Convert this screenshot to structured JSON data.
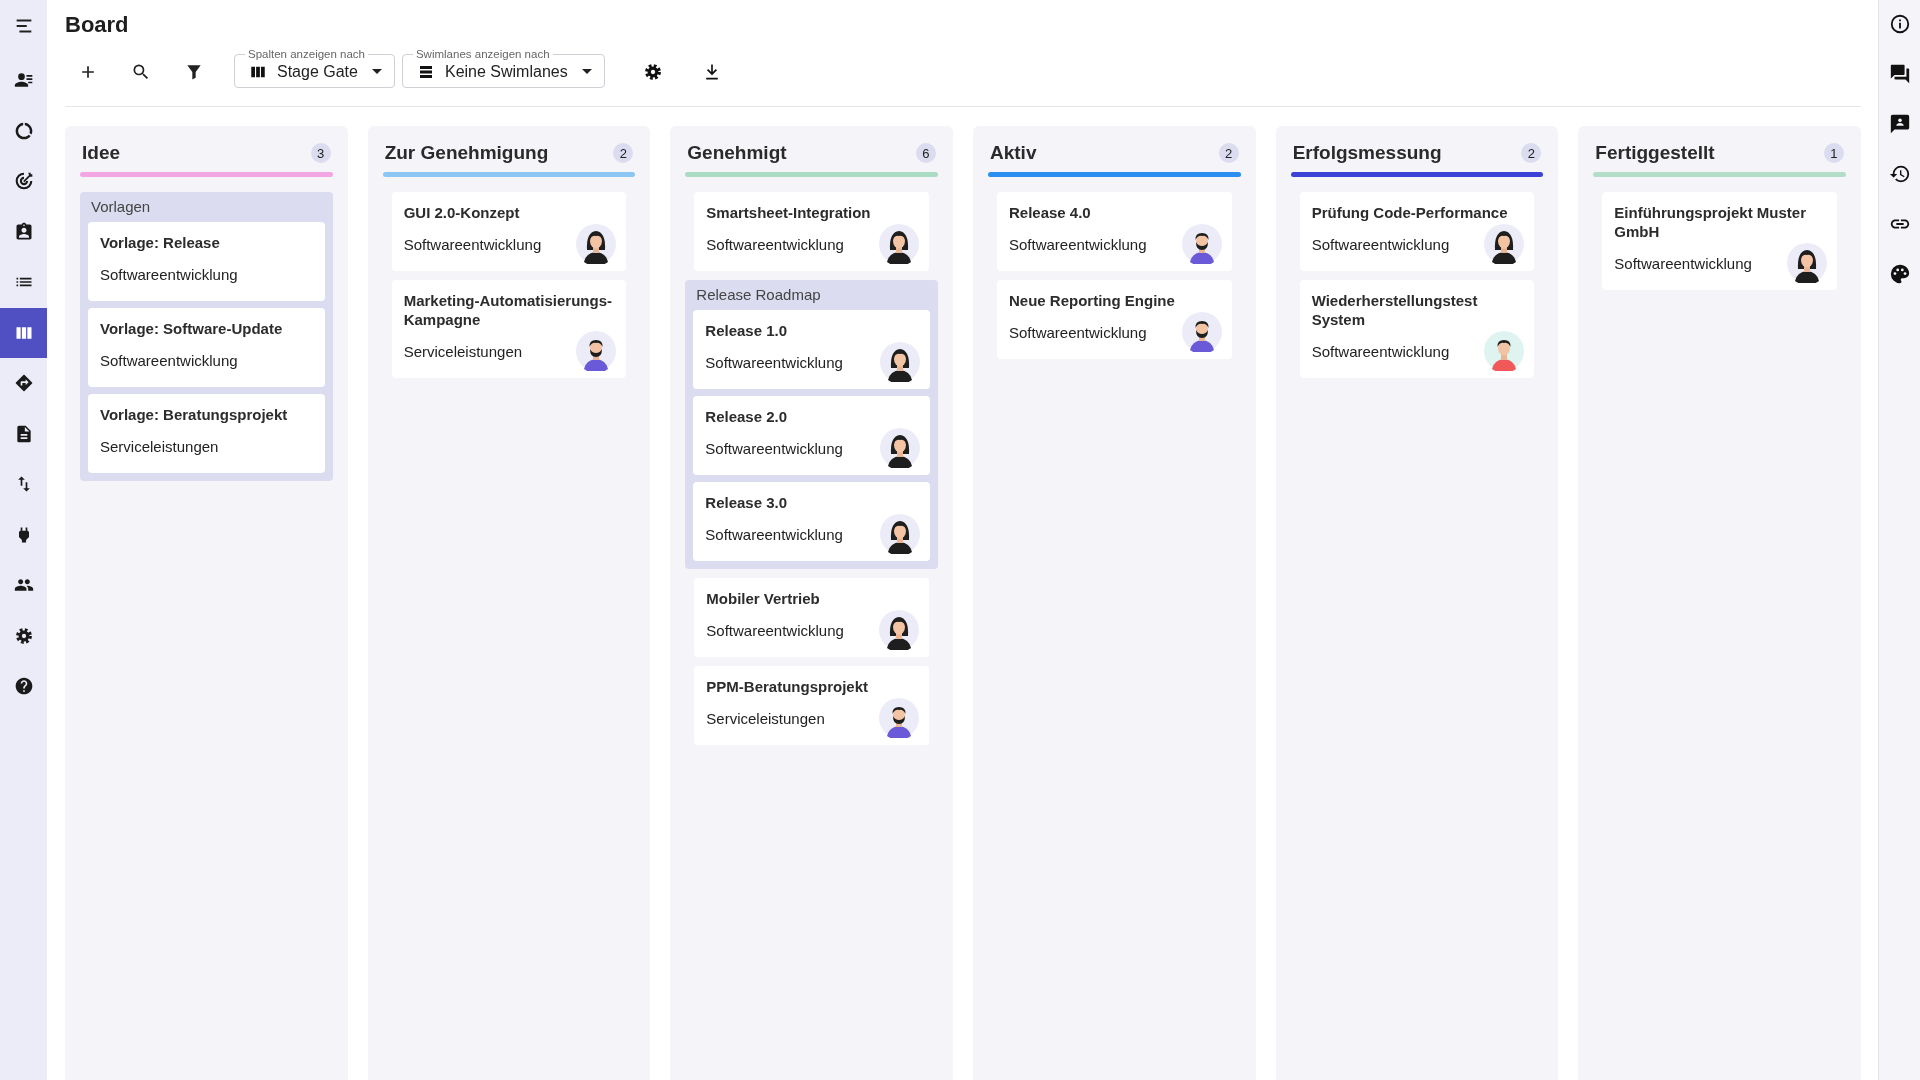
{
  "app": {
    "title": "Board"
  },
  "nav": [
    {
      "selected": false
    },
    {
      "selected": false
    },
    {
      "selected": false
    },
    {
      "selected": false
    },
    {
      "selected": false
    },
    {
      "selected": true
    },
    {
      "selected": false
    },
    {
      "selected": false
    },
    {
      "selected": false
    },
    {
      "selected": false
    },
    {
      "selected": false
    },
    {
      "selected": false
    },
    {
      "selected": false
    }
  ],
  "toolbar": {
    "columns_select": {
      "label": "Spalten anzeigen nach",
      "value": "Stage Gate"
    },
    "swimlanes_select": {
      "label": "Swimlanes anzeigen nach",
      "value": "Keine Swimlanes"
    }
  },
  "columns": [
    {
      "title": "Idee",
      "count": "3",
      "color": "#f2a6e4",
      "items": [
        {
          "kind": "group",
          "label": "Vorlagen",
          "cards": [
            {
              "title": "Vorlage: Release",
              "subtitle": "Softwareentwicklung"
            },
            {
              "title": "Vorlage: Software-Update",
              "subtitle": "Softwareentwicklung"
            },
            {
              "title": "Vorlage: Beratungsprojekt",
              "subtitle": "Serviceleistungen"
            }
          ]
        }
      ]
    },
    {
      "title": "Zur Genehmigung",
      "count": "2",
      "color": "#8cc6f2",
      "items": [
        {
          "kind": "card",
          "title": "GUI 2.0-Konzept",
          "subtitle": "Softwareentwicklung",
          "avatar": {
            "kind": "a"
          }
        },
        {
          "kind": "card",
          "title": "Marketing-Automatisierungs-Kampagne",
          "subtitle": "Serviceleistungen",
          "avatar": {
            "kind": "b"
          }
        }
      ]
    },
    {
      "title": "Genehmigt",
      "count": "6",
      "color": "#a9dcc3",
      "items": [
        {
          "kind": "card",
          "title": "Smartsheet-Integration",
          "subtitle": "Softwareentwicklung",
          "avatar": {
            "kind": "a"
          }
        },
        {
          "kind": "group",
          "label": "Release Roadmap",
          "cards": [
            {
              "title": "Release 1.0",
              "subtitle": "Softwareentwicklung",
              "avatar": {
                "kind": "a"
              }
            },
            {
              "title": "Release 2.0",
              "subtitle": "Softwareentwicklung",
              "avatar": {
                "kind": "a"
              }
            },
            {
              "title": "Release 3.0",
              "subtitle": "Softwareentwicklung",
              "avatar": {
                "kind": "a"
              }
            }
          ]
        },
        {
          "kind": "card",
          "title": "Mobiler Vertrieb",
          "subtitle": "Softwareentwicklung",
          "avatar": {
            "kind": "a"
          }
        },
        {
          "kind": "card",
          "title": "PPM-Beratungsprojekt",
          "subtitle": "Serviceleistungen",
          "avatar": {
            "kind": "b"
          }
        }
      ]
    },
    {
      "title": "Aktiv",
      "count": "2",
      "color": "#2b8ef0",
      "items": [
        {
          "kind": "card",
          "title": "Release 4.0",
          "subtitle": "Softwareentwicklung",
          "avatar": {
            "kind": "b"
          }
        },
        {
          "kind": "card",
          "title": "Neue Reporting Engine",
          "subtitle": "Softwareentwicklung",
          "avatar": {
            "kind": "b"
          }
        }
      ]
    },
    {
      "title": "Erfolgsmessung",
      "count": "2",
      "color": "#3b42d6",
      "items": [
        {
          "kind": "card",
          "title": "Prüfung Code-Performance",
          "subtitle": "Softwareentwicklung",
          "avatar": {
            "kind": "a"
          }
        },
        {
          "kind": "card",
          "title": "Wiederherstellungstest System",
          "subtitle": "Softwareentwicklung",
          "avatar": {
            "kind": "c"
          }
        }
      ]
    },
    {
      "title": "Fertiggestellt",
      "count": "1",
      "color": "#b2dec9",
      "items": [
        {
          "kind": "card",
          "title": "Einführungsprojekt Muster GmbH",
          "subtitle": "Softwareentwicklung",
          "avatar": {
            "kind": "a"
          }
        }
      ]
    }
  ]
}
